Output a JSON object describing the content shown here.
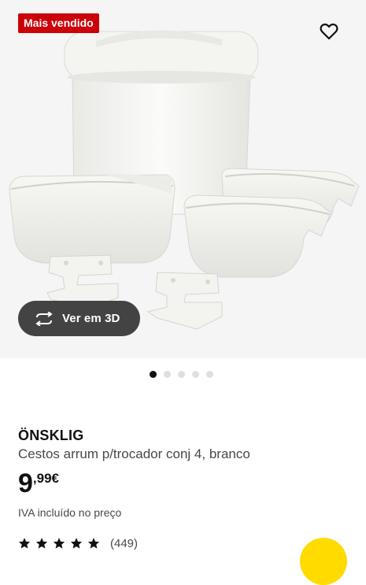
{
  "hero": {
    "badge": "Mais vendido",
    "view_3d_label": "Ver em 3D",
    "icons": {
      "favorite": "heart-outline-icon",
      "rotate_3d": "rotate-arrows-icon"
    }
  },
  "carousel": {
    "total": 5,
    "active": 1
  },
  "product": {
    "name": "ÖNSKLIG",
    "description": "Cestos arrum p/trocador conj 4, branco",
    "price_integer": "9",
    "price_decimal": ",99€",
    "vat_note": "IVA incluído no preço",
    "rating_stars": 5,
    "rating_count": "(449)"
  },
  "colors": {
    "badge_bg": "#cc0008",
    "button_3d_bg": "#434343",
    "fab_bg": "#ffdb00",
    "image_bg": "#f5f5f5"
  }
}
